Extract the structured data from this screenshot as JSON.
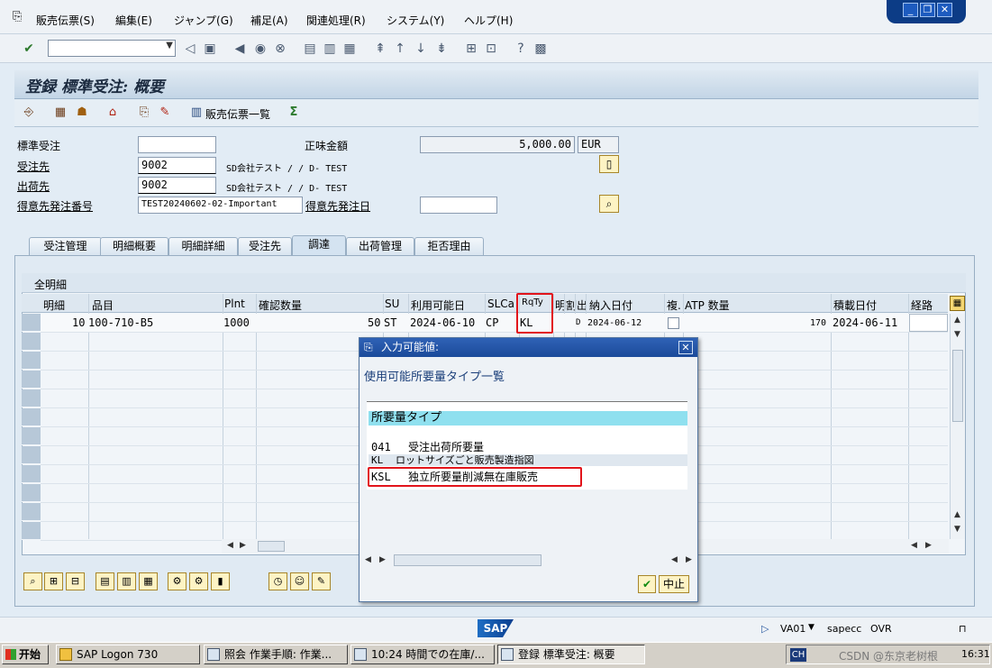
{
  "menu": {
    "items": [
      "販売伝票(S)",
      "編集(E)",
      "ジャンプ(G)",
      "補足(A)",
      "関連処理(R)",
      "システム(Y)",
      "ヘルプ(H)"
    ]
  },
  "window_controls": {
    "minimize": "_",
    "restore": "❐",
    "close": "✕"
  },
  "page": {
    "title": "登録 標準受注: 概要"
  },
  "app_toolbar": {
    "doc_list_label": "販売伝票一覧"
  },
  "header": {
    "order_type_label": "標準受注",
    "order_type_value": "",
    "net_value_label": "正味金額",
    "net_value": "5,000.00",
    "currency": "EUR",
    "sold_to_label": "受注先",
    "sold_to_value": "9002",
    "sold_to_desc": "SD会社テスト / / D- TEST",
    "ship_to_label": "出荷先",
    "ship_to_value": "9002",
    "ship_to_desc": "SD会社テスト / / D- TEST",
    "po_label": "得意先発注番号",
    "po_value": "TEST20240602-02-Important",
    "po_date_label": "得意先発注日",
    "po_date_value": ""
  },
  "tabs": [
    "受注管理",
    "明細概要",
    "明細詳細",
    "受注先",
    "調達",
    "出荷管理",
    "拒否理由"
  ],
  "active_tab": "調達",
  "table": {
    "title": "全明細",
    "columns": [
      "明細",
      "品目",
      "Plnt",
      "確認数量",
      "SU",
      "利用可能日",
      "SLCa",
      "RqTy",
      "明",
      "割",
      "出",
      "納入日付",
      "複.",
      "ATP 数量",
      "積載日付",
      "経路"
    ],
    "rows": [
      {
        "item": "10",
        "material": "100-710-B5",
        "plant": "1000",
        "qty": "50",
        "su": "ST",
        "avail_date": "2024-06-10",
        "slca": "CP",
        "rqty": "KL",
        "col_d": "D",
        "delivery_date": "2024-06-12",
        "atp_qty": "170",
        "load_date": "2024-06-11"
      }
    ]
  },
  "popup": {
    "title": "入力可能値:",
    "subtitle": "使用可能所要量タイプ一覧",
    "header": "所要量タイプ",
    "items": [
      {
        "code": "041",
        "text": "受注出荷所要量"
      },
      {
        "code": "KL",
        "text": "ロットサイズごと販売製造指図"
      },
      {
        "code": "KSL",
        "text": "独立所要量削減無在庫販売"
      }
    ],
    "cancel_label": "中止",
    "ok_label": "✔"
  },
  "status": {
    "logo": "SAP",
    "transaction": "VA01",
    "server": "sapecc",
    "mode": "OVR"
  },
  "taskbar": {
    "start": "开始",
    "tasks": [
      "SAP Logon 730",
      "照会 作業手順: 作業...",
      "10:24 時間での在庫/...",
      "登録 標準受注: 概要"
    ],
    "lang": "CH",
    "clock": "16:31",
    "watermark": "CSDN @东京老树根"
  }
}
